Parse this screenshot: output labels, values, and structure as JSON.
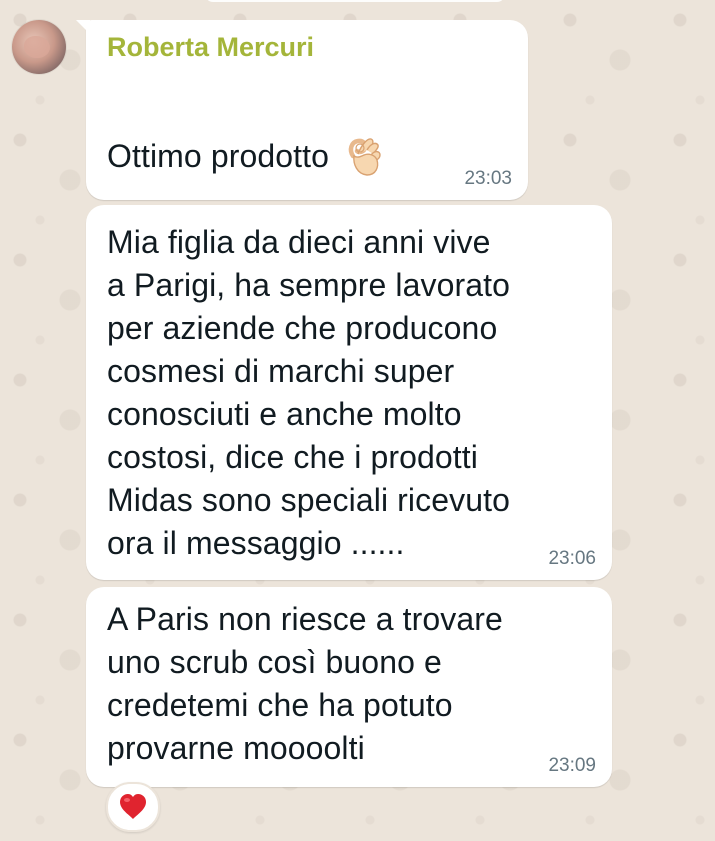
{
  "chat": {
    "messages": [
      {
        "sender": "Roberta Mercuri",
        "text_lines": [
          "Ottimo prodotto"
        ],
        "emoji": "ok-hand-emoji",
        "time": "23:03"
      },
      {
        "text_lines": [
          "Mia figlia da dieci anni vive",
          "a Parigi, ha sempre lavorato",
          "per aziende che producono",
          "cosmesi di marchi super",
          "conosciuti e anche molto",
          "costosi, dice che i prodotti",
          "Midas sono speciali ricevuto",
          "ora il messaggio ......"
        ],
        "time": "23:06"
      },
      {
        "text_lines": [
          "A Paris non riesce a trovare",
          "uno scrub così buono e",
          "credetemi che ha potuto",
          "provarne moooolti"
        ],
        "time": "23:09",
        "reaction": "red-heart-emoji"
      }
    ]
  },
  "colors": {
    "wallpaper": "#ece4da",
    "bubble": "#ffffff",
    "sender_name": "#a4b53a",
    "text": "#111b21",
    "timestamp": "#667781",
    "heart": "#e0242f"
  }
}
